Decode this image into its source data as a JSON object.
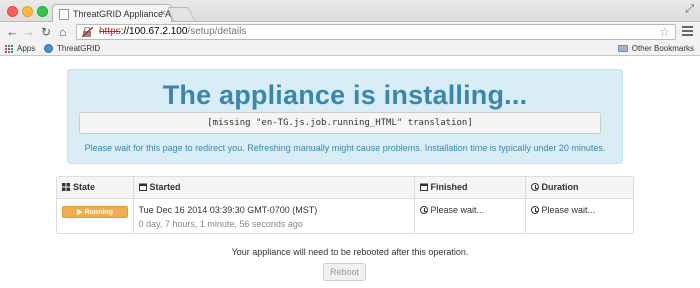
{
  "browser": {
    "tab_title": "ThreatGRID Appliance Adr",
    "url_scheme": "https",
    "url_host": "://100.67.2.100",
    "url_path": "/setup/details",
    "bookmarks": {
      "apps_label": "Apps",
      "threatgrid_label": "ThreatGRID",
      "other_label": "Other Bookmarks"
    }
  },
  "hero": {
    "title": "The appliance is installing...",
    "code_message": "[missing \"en-TG.js.job.running_HTML\" translation]",
    "note": "Please wait for this page to redirect you. Refreshing manually might cause problems. Installation time is typically under 20 minutes."
  },
  "table": {
    "headers": {
      "state": "State",
      "started": "Started",
      "finished": "Finished",
      "duration": "Duration"
    },
    "row": {
      "state": "Running",
      "started_date": "Tue Dec 16 2014 03:39:30 GMT-0700 (MST)",
      "started_elapsed": "0 day, 7 hours, 1 minute, 56 seconds ago",
      "finished": "Please wait...",
      "duration": "Please wait..."
    }
  },
  "footer": {
    "note": "Your appliance will need to be rebooted after this operation.",
    "reboot_label": "Reboot"
  },
  "colors": {
    "hero_bg": "#d9edf7",
    "hero_text": "#3a87ad",
    "badge_bg": "#f0ad4e"
  }
}
